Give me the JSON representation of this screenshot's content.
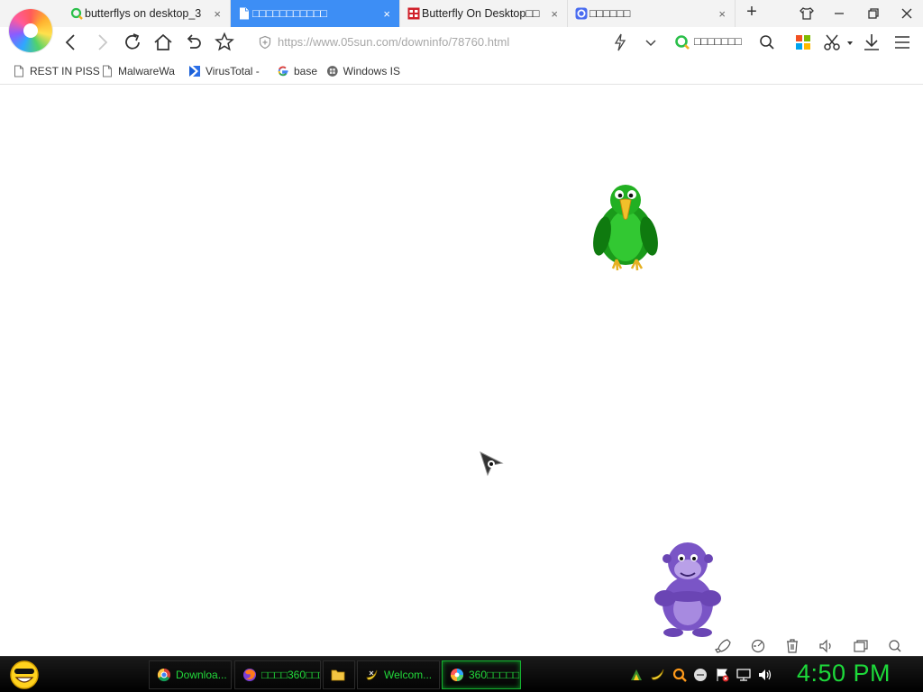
{
  "browser": {
    "tabs": [
      {
        "label": "butterflys on desktop_3",
        "active": false,
        "icon": "360-search-icon"
      },
      {
        "label": "□□□□□□□□□□□",
        "active": true,
        "icon": "page-icon"
      },
      {
        "label": "Butterfly On Desktop□□",
        "active": false,
        "icon": "site-favicon-red"
      },
      {
        "label": "□□□□□□",
        "active": false,
        "icon": "360-browser-icon"
      }
    ],
    "close_glyph": "×",
    "new_tab_glyph": "+",
    "address": {
      "url": "https://www.05sun.com/downinfo/78760.html"
    },
    "search_label": "□□□□□□□",
    "bookmarks": [
      {
        "label": "REST IN PISS",
        "icon": "page-icon"
      },
      {
        "label": "MalwareWa",
        "icon": "page-icon"
      },
      {
        "label": "VirusTotal -",
        "icon": "virustotal-icon"
      },
      {
        "label": "base",
        "icon": "google-icon"
      },
      {
        "label": "Windows IS",
        "icon": "windows-icon"
      }
    ]
  },
  "taskbar": {
    "items": [
      {
        "label": "Downloa...",
        "icon": "chrome-icon",
        "active": false
      },
      {
        "label": "□□□□360□□□...",
        "icon": "firefox-icon",
        "active": false
      },
      {
        "label": "",
        "icon": "folder-icon",
        "active": false
      },
      {
        "label": "Welcom...",
        "icon": "bonzi-banana-icon",
        "active": false
      },
      {
        "label": "360□□□□□",
        "icon": "360-browser-icon",
        "active": true
      }
    ],
    "clock": "4:50 PM"
  },
  "colors": {
    "active_tab": "#3d8ef5",
    "taskbar_text": "#22d83a",
    "clock": "#1dd93a"
  }
}
